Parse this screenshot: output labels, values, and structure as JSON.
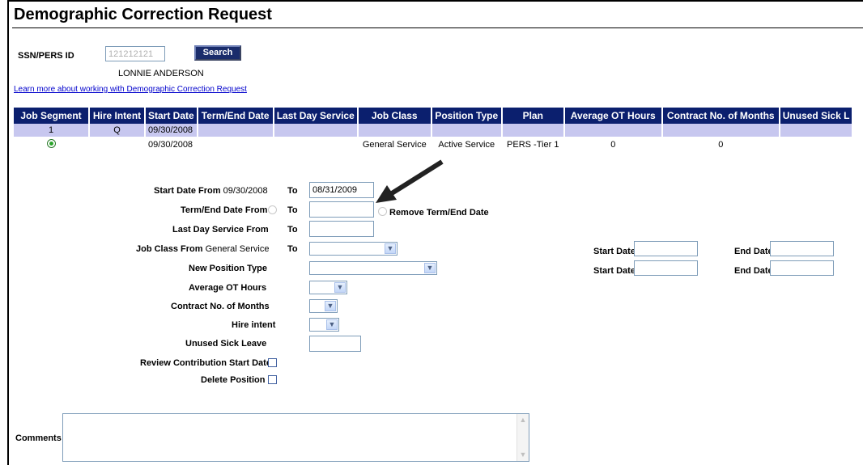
{
  "page": {
    "title": "Demographic Correction Request"
  },
  "lookup": {
    "ssn_label": "SSN/PERS ID",
    "ssn_value": "121212121",
    "search_label": "Search",
    "member_name": "LONNIE ANDERSON",
    "help_link": "Learn more about working with Demographic Correction Request"
  },
  "grid": {
    "headers": [
      "Job Segment",
      "Hire Intent",
      "Start Date",
      "Term/End Date",
      "Last Day Service",
      "Job Class",
      "Position Type",
      "Plan",
      "Average OT Hours",
      "Contract No. of Months",
      "Unused Sick L"
    ],
    "row1": [
      "1",
      "Q",
      "09/30/2008",
      "",
      "",
      "",
      "",
      "",
      "",
      "",
      ""
    ],
    "row2": [
      "",
      "",
      "09/30/2008",
      "",
      "",
      "General Service",
      "Active Service",
      "PERS -Tier 1",
      "0",
      "0",
      ""
    ]
  },
  "form": {
    "start_date_from_label": "Start Date From",
    "start_date_from_value": "09/30/2008",
    "to_label": "To",
    "start_date_to_value": "08/31/2009",
    "term_end_from_label": "Term/End Date From",
    "remove_term_label": "Remove Term/End Date",
    "last_day_service_label": "Last Day Service From",
    "job_class_from_label": "Job Class From",
    "job_class_from_value": "General Service",
    "new_position_type_label": "New Position Type",
    "average_ot_label": "Average OT Hours",
    "contract_months_label": "Contract No. of Months",
    "hire_intent_label": "Hire intent",
    "unused_sick_label": "Unused Sick Leave",
    "review_contribution_label": "Review Contribution Start Date",
    "delete_position_label": "Delete Position",
    "start_date_label": "Start Date",
    "end_date_label": "End Date",
    "comments_label": "Comments"
  },
  "colors": {
    "header_bg": "#0b1f6e",
    "row1_bg": "#c7c7ef",
    "row2_bg": "#d9d9f5",
    "link": "#0000cc"
  }
}
